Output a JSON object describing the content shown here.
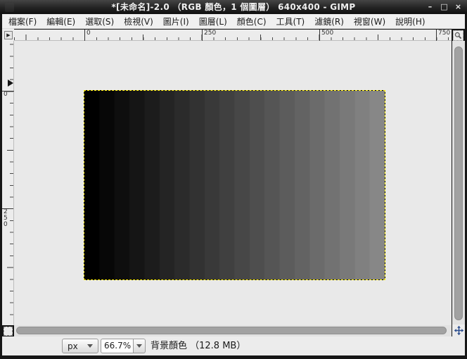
{
  "window": {
    "title": "*[未命名]-2.0 （RGB 顏色，1 個圖層） 640x400 - GIMP",
    "controls": {
      "minimize": "–",
      "maximize": "□",
      "close": "×"
    }
  },
  "menu": {
    "items": [
      "檔案(F)",
      "編輯(E)",
      "選取(S)",
      "檢視(V)",
      "圖片(I)",
      "圖層(L)",
      "顏色(C)",
      "工具(T)",
      "濾鏡(R)",
      "視窗(W)",
      "說明(H)"
    ]
  },
  "rulers": {
    "corner_button_glyph": "▶",
    "h_labels": [
      "0",
      "250",
      "500",
      "750"
    ],
    "v_labels": [
      "0",
      "250"
    ]
  },
  "canvas": {
    "image_size_label": "640x400",
    "zoom_percent": "66.7%",
    "gradient_steps": [
      "#000000",
      "#070707",
      "#0e0e0e",
      "#151515",
      "#1c1c1c",
      "#242424",
      "#2b2b2b",
      "#323232",
      "#393939",
      "#404040",
      "#474747",
      "#4e4e4e",
      "#555555",
      "#5c5c5c",
      "#636363",
      "#6b6b6b",
      "#727272",
      "#797979",
      "#808080",
      "#878787"
    ]
  },
  "statusbar": {
    "unit_value": "px",
    "zoom_value": "66.7%",
    "message": "背景顏色 （12.8 MB）"
  },
  "colors": {
    "layer_boundary": "#ffee00",
    "pan_icon": "#2b4d8e",
    "titlebar_bg": "#232323",
    "ui_bg": "#ececec",
    "scrollbar_thumb": "#a2a2a2"
  }
}
